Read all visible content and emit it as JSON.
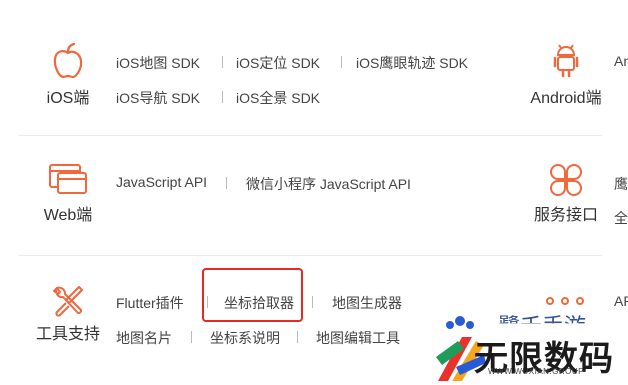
{
  "accent_color": "#f0683c",
  "rows": {
    "ios": {
      "category": "iOS端",
      "icon": "apple-icon",
      "links": [
        "iOS地图 SDK",
        "iOS定位 SDK",
        "iOS鹰眼轨迹 SDK",
        "iOS导航 SDK",
        "iOS全景 SDK"
      ],
      "right_category": "Android端",
      "right_icon": "android-icon",
      "right_clip_text": "An"
    },
    "web": {
      "category": "Web端",
      "icon": "browser-windows-icon",
      "links": [
        "JavaScript API",
        "微信小程序 JavaScript API"
      ],
      "right_category": "服务接口",
      "right_icon": "clover-icon",
      "right_clip_text": "鹰",
      "right_clip_text2": "全"
    },
    "tools": {
      "category": "工具支持",
      "icon": "tools-icon",
      "links": [
        "Flutter插件",
        "坐标拾取器",
        "地图生成器",
        "地图名片",
        "坐标系说明",
        "地图编辑工具"
      ],
      "right_icon": "more-dots-icon",
      "right_clip_text": "AP"
    }
  },
  "watermark": {
    "top_text": "鹭禾手游",
    "main_text": "无限数码",
    "sub_text": "WWW.WUXIAN.GROUP"
  }
}
